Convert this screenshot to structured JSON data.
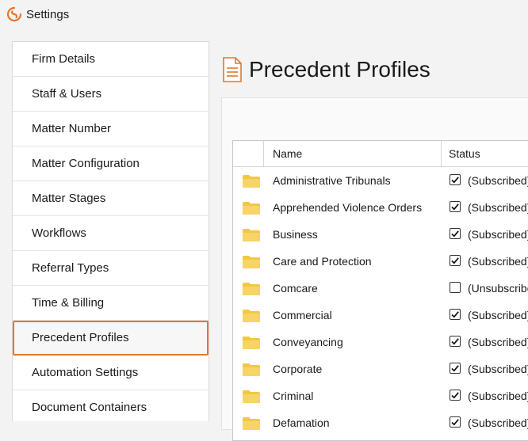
{
  "window": {
    "title": "Settings"
  },
  "colors": {
    "accent": "#e0782f",
    "folder": "#f2c744",
    "logo": "#e0782f"
  },
  "sidebar": {
    "items": [
      {
        "label": "Firm Details"
      },
      {
        "label": "Staff & Users"
      },
      {
        "label": "Matter Number"
      },
      {
        "label": "Matter Configuration"
      },
      {
        "label": "Matter Stages"
      },
      {
        "label": "Workflows"
      },
      {
        "label": "Referral Types"
      },
      {
        "label": "Time & Billing"
      },
      {
        "label": "Precedent Profiles",
        "selected": true
      },
      {
        "label": "Automation Settings"
      },
      {
        "label": "Document Containers"
      }
    ]
  },
  "main": {
    "title": "Precedent Profiles",
    "title_icon": "document-icon",
    "table": {
      "columns": [
        "Name",
        "Status"
      ],
      "rows": [
        {
          "name": "Administrative Tribunals",
          "checked": true,
          "status": "(Subscribed)"
        },
        {
          "name": "Apprehended Violence Orders",
          "checked": true,
          "status": "(Subscribed)"
        },
        {
          "name": "Business",
          "checked": true,
          "status": "(Subscribed)"
        },
        {
          "name": "Care and Protection",
          "checked": true,
          "status": "(Subscribed)"
        },
        {
          "name": "Comcare",
          "checked": false,
          "status": "(Unsubscribed)"
        },
        {
          "name": "Commercial",
          "checked": true,
          "status": "(Subscribed)"
        },
        {
          "name": "Conveyancing",
          "checked": true,
          "status": "(Subscribed)"
        },
        {
          "name": "Corporate",
          "checked": true,
          "status": "(Subscribed)"
        },
        {
          "name": "Criminal",
          "checked": true,
          "status": "(Subscribed)"
        },
        {
          "name": "Defamation",
          "checked": true,
          "status": "(Subscribed)"
        }
      ]
    }
  }
}
